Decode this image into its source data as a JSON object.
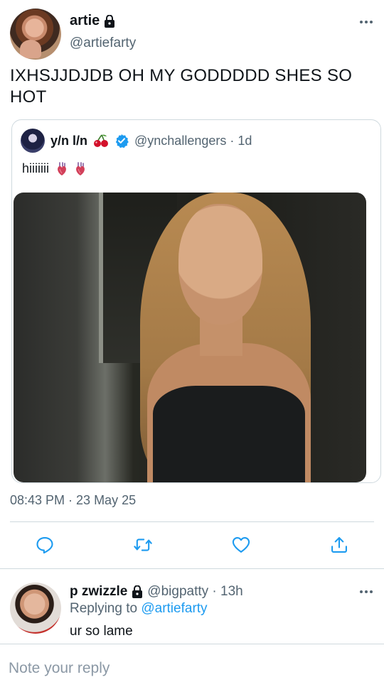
{
  "tweet": {
    "author_name": "artie",
    "author_handle": "@artiefarty",
    "text": "IXHSJJDJDB OH MY GODDDDD SHES SO HOT",
    "timestamp": "08:43 PM · 23 May 25"
  },
  "quote": {
    "name": "y/n l/n",
    "handle": "@ynchallengers · 1d",
    "text": "hiiiiiii"
  },
  "reply": {
    "name": "p zwizzle",
    "handle": "@bigpatty · 13h",
    "replying_prefix": "Replying to ",
    "replying_mention": "@artiefarty",
    "text": "ur so lame"
  },
  "compose": {
    "placeholder": "Note your reply"
  },
  "icons": {
    "lock": "lock-icon",
    "verified": "verified-badge-icon",
    "cherry": "cherry-emoji-icon",
    "anatomical_heart": "anatomical-heart-emoji-icon",
    "reply": "reply-icon",
    "retweet": "retweet-icon",
    "like": "heart-icon",
    "share": "share-icon",
    "more": "more-options-icon"
  },
  "colors": {
    "text": "#0f1419",
    "secondary": "#536471",
    "link": "#1d9bf0",
    "verified": "#1d9bf0",
    "border": "#cfd9de"
  }
}
